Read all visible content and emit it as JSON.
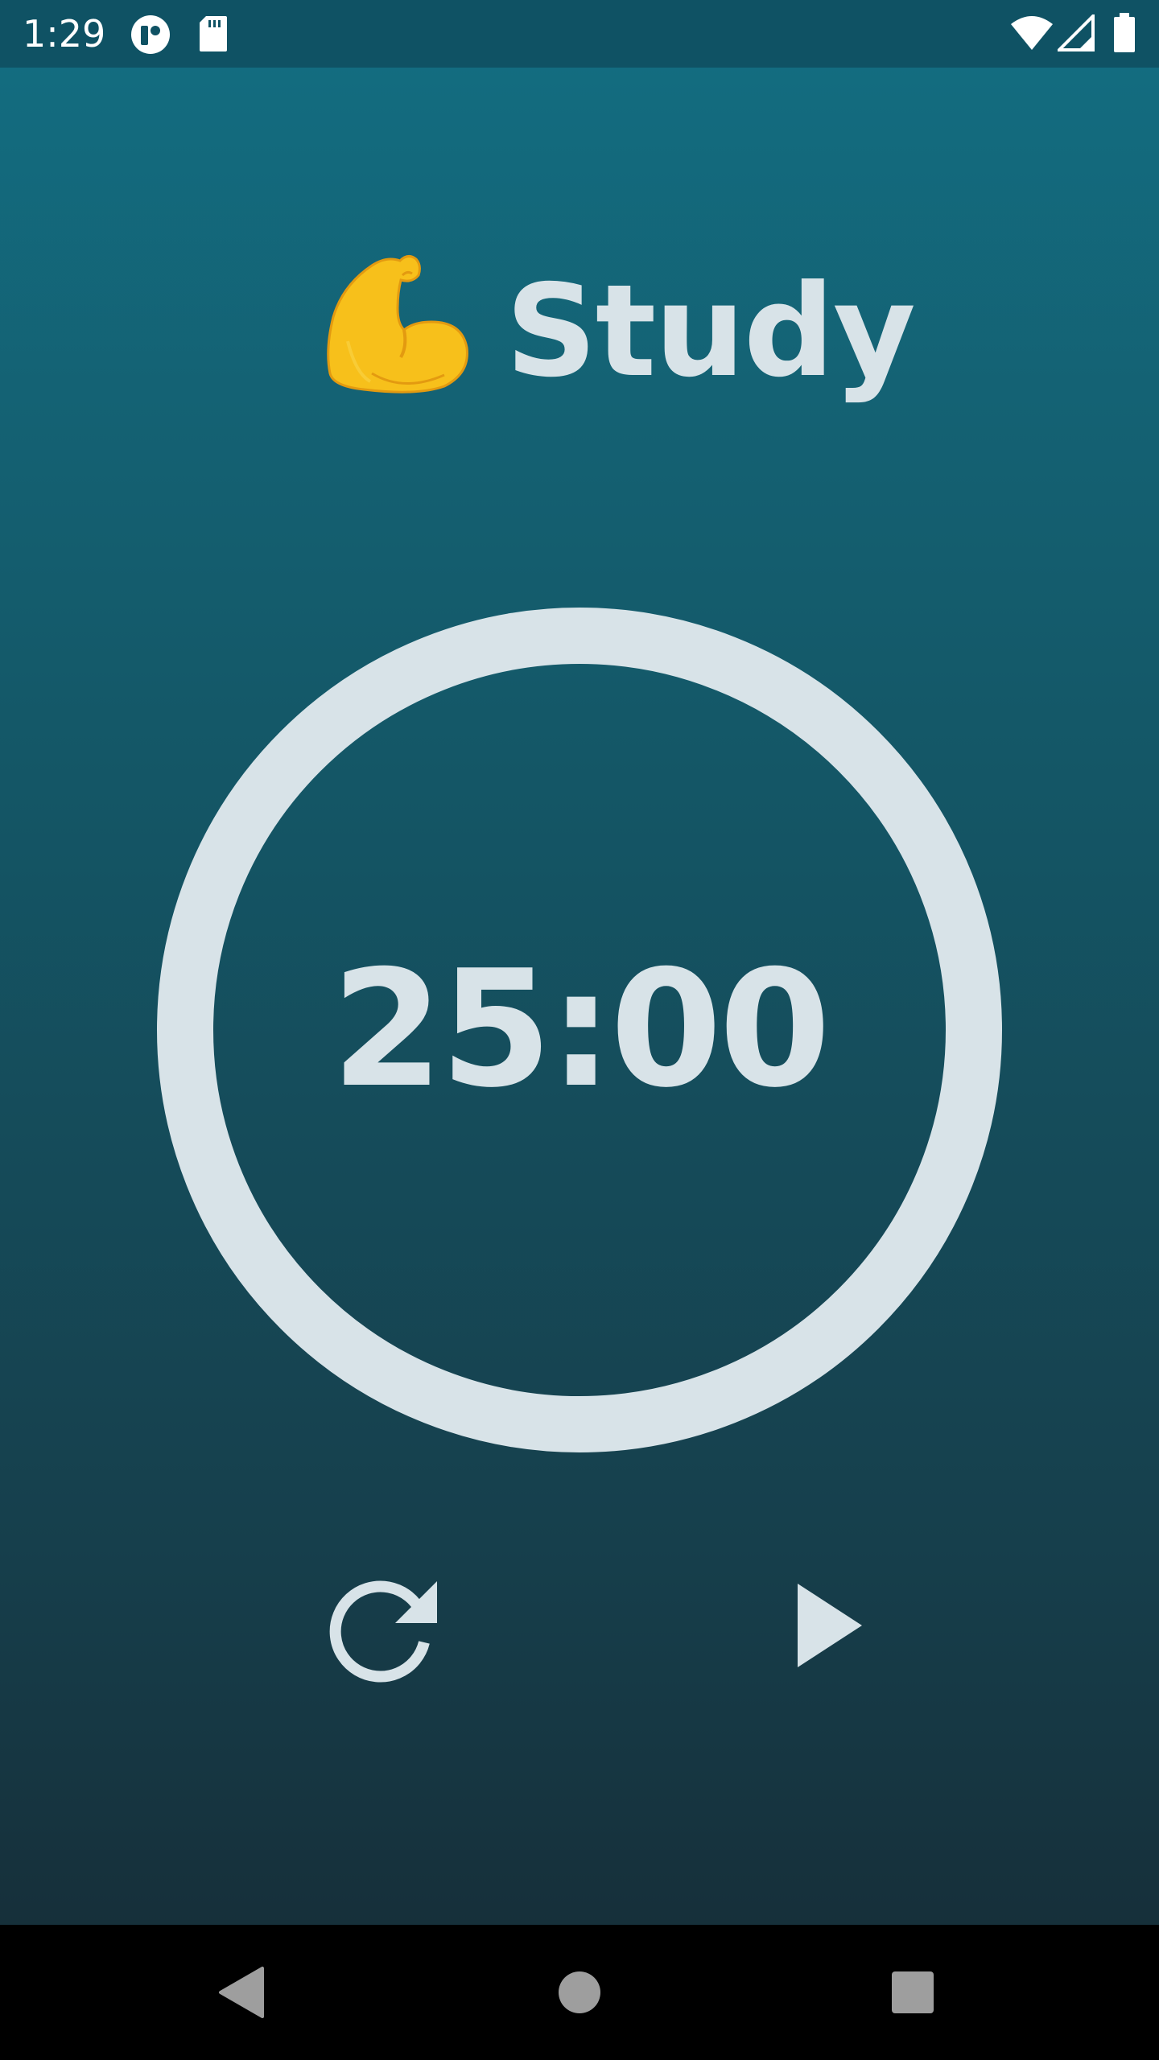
{
  "status_bar": {
    "time": "1:29",
    "left_icons": [
      "notification-app-icon",
      "sd-card-icon"
    ],
    "right_icons": [
      "wifi-icon",
      "cell-signal-icon",
      "battery-icon"
    ]
  },
  "header": {
    "emoji_icon": "flexed-biceps-icon",
    "title": "Study"
  },
  "timer": {
    "display": "25:00",
    "progress": 1.0
  },
  "controls": {
    "reset_icon": "reset-icon",
    "play_icon": "play-icon"
  },
  "nav_bar": {
    "buttons": [
      "back-icon",
      "home-icon",
      "recents-icon"
    ]
  },
  "colors": {
    "background_top": "#136e82",
    "background_bottom": "#162a34",
    "foreground": "#d8e3e8",
    "emoji_yellow": "#f7c01b"
  }
}
